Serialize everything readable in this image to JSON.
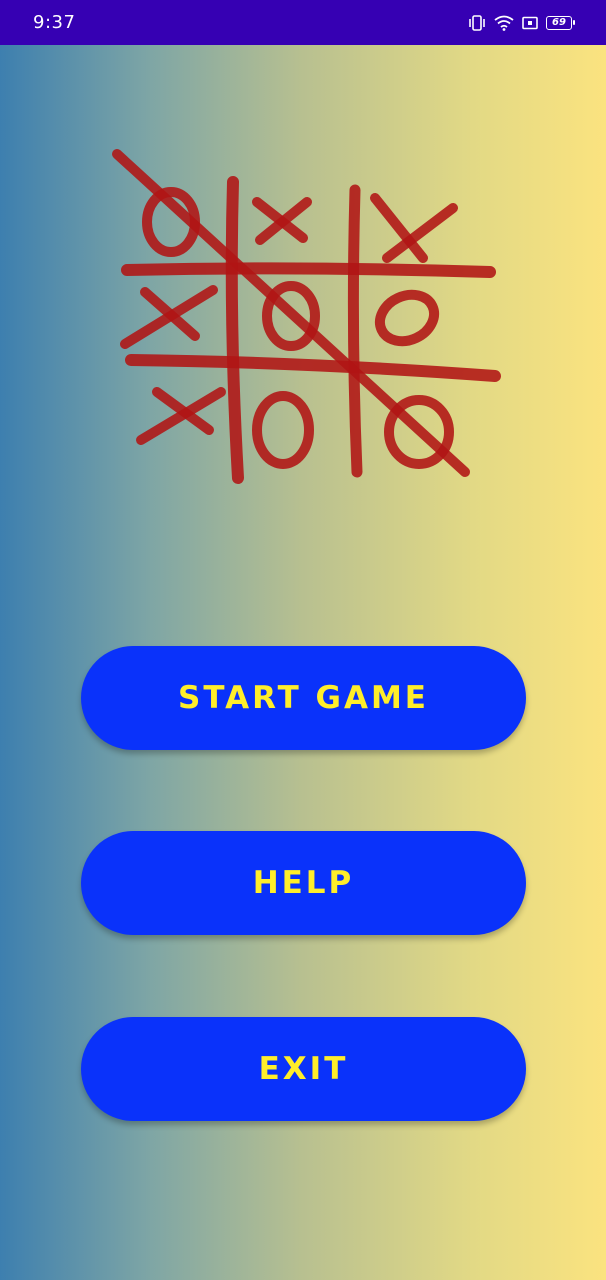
{
  "status_bar": {
    "time": "9:37",
    "battery_level": "69",
    "icons": [
      "vibrate-icon",
      "wifi-icon",
      "screen-record-icon",
      "battery-icon"
    ],
    "background": "#3600b3"
  },
  "logo": {
    "icon": "tic-tac-toe-logo",
    "color": "#b01515"
  },
  "menu": {
    "start_label": "START GAME",
    "help_label": "HELP",
    "exit_label": "EXIT",
    "button_color": "#0a32fa",
    "text_color": "#ffee2a"
  },
  "background": {
    "gradient_left": "#3d7faf",
    "gradient_right": "#fbe37f"
  }
}
